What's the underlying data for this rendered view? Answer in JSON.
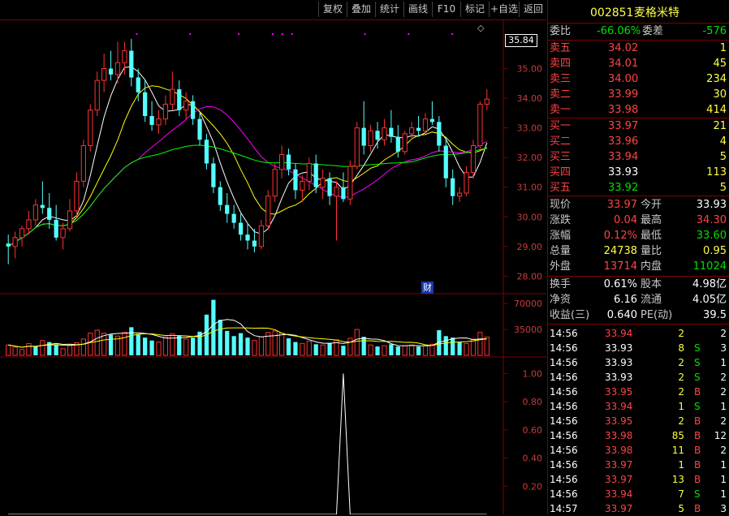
{
  "toolbar": {
    "buttons": [
      "复权",
      "叠加",
      "统计",
      "画线",
      "F10",
      "标记",
      "+自选",
      "返回"
    ]
  },
  "price_chart": {
    "current_tag": "35.84",
    "y_ticks": [
      "35.00",
      "34.00",
      "33.00",
      "32.00",
      "31.00",
      "30.00",
      "29.00",
      "28.00"
    ],
    "marker_text": "财"
  },
  "volume_chart": {
    "y_ticks": [
      "70000",
      "35000"
    ]
  },
  "indicator_chart": {
    "y_ticks": [
      "1.00",
      "0.80",
      "0.60",
      "0.40",
      "0.20"
    ]
  },
  "stock": {
    "code": "002851",
    "name": "麦格米特"
  },
  "committee": {
    "ratio_label": "委比",
    "ratio_value": "-66.06%",
    "diff_label": "委差",
    "diff_value": "-576"
  },
  "sell_orders": [
    {
      "label": "卖五",
      "price": "34.02",
      "vol": "1"
    },
    {
      "label": "卖四",
      "price": "34.01",
      "vol": "45"
    },
    {
      "label": "卖三",
      "price": "34.00",
      "vol": "234"
    },
    {
      "label": "卖二",
      "price": "33.99",
      "vol": "30"
    },
    {
      "label": "卖一",
      "price": "33.98",
      "vol": "414"
    }
  ],
  "buy_orders": [
    {
      "label": "买一",
      "price": "33.97",
      "vol": "21"
    },
    {
      "label": "买二",
      "price": "33.96",
      "vol": "4"
    },
    {
      "label": "买三",
      "price": "33.94",
      "vol": "5"
    },
    {
      "label": "买四",
      "price": "33.93",
      "vol": "113"
    },
    {
      "label": "买五",
      "price": "33.92",
      "vol": "5"
    }
  ],
  "quote": [
    {
      "l1": "现价",
      "v1": "33.97",
      "l2": "今开",
      "v2": "33.93"
    },
    {
      "l1": "涨跌",
      "v1": "0.04",
      "l2": "最高",
      "v2": "34.30"
    },
    {
      "l1": "涨幅",
      "v1": "0.12%",
      "l2": "最低",
      "v2": "33.60"
    },
    {
      "l1": "总量",
      "v1": "24738",
      "l2": "量比",
      "v2": "0.95"
    },
    {
      "l1": "外盘",
      "v1": "13714",
      "l2": "内盘",
      "v2": "11024"
    }
  ],
  "fundamentals": [
    {
      "l1": "换手",
      "v1": "0.61%",
      "l2": "股本",
      "v2": "4.98亿"
    },
    {
      "l1": "净资",
      "v1": "6.16",
      "l2": "流通",
      "v2": "4.05亿"
    },
    {
      "l1": "收益(三)",
      "v1": "0.640",
      "l2": "PE(动)",
      "v2": "39.5"
    }
  ],
  "ticks": [
    {
      "time": "14:56",
      "price": "33.94",
      "vol": "2",
      "dir": "",
      "n": "2"
    },
    {
      "time": "14:56",
      "price": "33.93",
      "vol": "8",
      "dir": "S",
      "n": "3"
    },
    {
      "time": "14:56",
      "price": "33.93",
      "vol": "2",
      "dir": "S",
      "n": "1"
    },
    {
      "time": "14:56",
      "price": "33.93",
      "vol": "2",
      "dir": "S",
      "n": "2"
    },
    {
      "time": "14:56",
      "price": "33.95",
      "vol": "2",
      "dir": "B",
      "n": "2"
    },
    {
      "time": "14:56",
      "price": "33.94",
      "vol": "1",
      "dir": "S",
      "n": "1"
    },
    {
      "time": "14:56",
      "price": "33.95",
      "vol": "2",
      "dir": "B",
      "n": "2"
    },
    {
      "time": "14:56",
      "price": "33.98",
      "vol": "85",
      "dir": "B",
      "n": "12"
    },
    {
      "time": "14:56",
      "price": "33.98",
      "vol": "11",
      "dir": "B",
      "n": "2"
    },
    {
      "time": "14:56",
      "price": "33.97",
      "vol": "1",
      "dir": "B",
      "n": "1"
    },
    {
      "time": "14:56",
      "price": "33.97",
      "vol": "13",
      "dir": "B",
      "n": "1"
    },
    {
      "time": "14:56",
      "price": "33.94",
      "vol": "7",
      "dir": "S",
      "n": "1"
    },
    {
      "time": "14:57",
      "price": "33.97",
      "vol": "5",
      "dir": "B",
      "n": "3"
    }
  ],
  "colors": {
    "up": "#ff3232",
    "down": "#54ffff",
    "ma5": "#ffffff",
    "ma10": "#ffff00",
    "ma20": "#ff00ff",
    "ma60": "#00ff00",
    "frame": "#800000"
  },
  "chart_data": {
    "type": "candlestick",
    "ylim": [
      27.6,
      36.3
    ],
    "volume_ylim": [
      0,
      80000
    ],
    "indicator_ylim": [
      0,
      1.1
    ],
    "candles": [
      [
        29.1,
        29.4,
        28.4,
        29.0
      ],
      [
        29.0,
        29.5,
        28.6,
        29.3
      ],
      [
        29.3,
        29.7,
        29.0,
        29.6
      ],
      [
        29.6,
        30.2,
        29.4,
        29.9
      ],
      [
        29.9,
        30.6,
        29.7,
        30.4
      ],
      [
        30.4,
        31.2,
        30.1,
        30.3
      ],
      [
        30.3,
        30.8,
        29.6,
        29.9
      ],
      [
        29.9,
        30.4,
        29.2,
        29.3
      ],
      [
        29.3,
        29.8,
        28.9,
        29.6
      ],
      [
        29.6,
        30.6,
        29.5,
        30.2
      ],
      [
        30.2,
        31.5,
        30.0,
        31.2
      ],
      [
        31.2,
        32.6,
        31.0,
        32.4
      ],
      [
        32.4,
        33.8,
        32.2,
        33.6
      ],
      [
        33.6,
        34.9,
        33.4,
        34.6
      ],
      [
        34.6,
        35.5,
        34.2,
        35.0
      ],
      [
        35.0,
        35.6,
        34.6,
        34.8
      ],
      [
        34.8,
        35.9,
        34.5,
        35.2
      ],
      [
        35.2,
        35.9,
        34.8,
        35.6
      ],
      [
        35.6,
        36.0,
        34.4,
        34.7
      ],
      [
        34.7,
        35.0,
        33.9,
        34.2
      ],
      [
        34.2,
        34.6,
        33.2,
        33.4
      ],
      [
        33.4,
        33.9,
        32.9,
        33.1
      ],
      [
        33.1,
        33.6,
        32.8,
        33.3
      ],
      [
        33.3,
        34.1,
        33.1,
        33.8
      ],
      [
        33.8,
        34.9,
        33.6,
        34.3
      ],
      [
        34.3,
        34.6,
        33.4,
        33.6
      ],
      [
        33.6,
        34.2,
        33.3,
        33.9
      ],
      [
        33.9,
        34.1,
        33.1,
        33.3
      ],
      [
        33.3,
        33.5,
        32.4,
        32.6
      ],
      [
        32.6,
        32.8,
        31.6,
        31.8
      ],
      [
        31.8,
        32.0,
        30.8,
        31.0
      ],
      [
        31.0,
        31.2,
        30.2,
        30.4
      ],
      [
        30.4,
        30.8,
        29.8,
        30.1
      ],
      [
        30.1,
        30.4,
        29.6,
        29.8
      ],
      [
        29.8,
        30.1,
        29.2,
        29.4
      ],
      [
        29.4,
        29.8,
        28.9,
        29.2
      ],
      [
        29.2,
        29.6,
        28.8,
        29.0
      ],
      [
        29.0,
        29.9,
        28.9,
        29.7
      ],
      [
        29.7,
        30.9,
        29.6,
        30.7
      ],
      [
        30.7,
        31.8,
        30.5,
        31.6
      ],
      [
        31.6,
        32.4,
        31.3,
        32.1
      ],
      [
        32.1,
        32.3,
        31.4,
        31.6
      ],
      [
        31.6,
        31.8,
        30.6,
        30.9
      ],
      [
        30.9,
        31.4,
        30.5,
        31.2
      ],
      [
        31.2,
        32.0,
        30.9,
        31.8
      ],
      [
        31.8,
        32.1,
        30.8,
        31.0
      ],
      [
        31.0,
        31.6,
        30.6,
        31.3
      ],
      [
        31.3,
        31.5,
        30.4,
        30.7
      ],
      [
        30.7,
        31.2,
        29.2,
        31.0
      ],
      [
        31.0,
        31.5,
        30.5,
        30.6
      ],
      [
        30.6,
        31.9,
        30.4,
        31.7
      ],
      [
        31.7,
        33.2,
        31.6,
        33.0
      ],
      [
        33.0,
        33.9,
        32.1,
        32.4
      ],
      [
        32.4,
        33.1,
        32.2,
        32.9
      ],
      [
        32.9,
        33.2,
        32.3,
        32.6
      ],
      [
        32.6,
        33.3,
        32.4,
        33.0
      ],
      [
        33.0,
        33.6,
        32.5,
        32.7
      ],
      [
        32.7,
        33.1,
        32.0,
        32.2
      ],
      [
        32.2,
        32.9,
        32.1,
        32.8
      ],
      [
        32.8,
        33.2,
        32.6,
        33.0
      ],
      [
        33.0,
        33.4,
        32.7,
        32.9
      ],
      [
        32.9,
        33.5,
        32.8,
        33.3
      ],
      [
        33.3,
        33.9,
        33.1,
        33.2
      ],
      [
        33.2,
        33.4,
        32.2,
        32.4
      ],
      [
        32.4,
        32.7,
        31.0,
        31.3
      ],
      [
        31.3,
        31.6,
        30.4,
        30.7
      ],
      [
        30.7,
        31.0,
        30.5,
        30.8
      ],
      [
        30.8,
        31.7,
        30.7,
        31.5
      ],
      [
        31.5,
        32.6,
        31.3,
        32.4
      ],
      [
        32.4,
        33.9,
        32.3,
        33.8
      ],
      [
        33.8,
        34.3,
        33.6,
        33.97
      ]
    ],
    "volumes": [
      [
        14000,
        1
      ],
      [
        11000,
        1
      ],
      [
        8000,
        1
      ],
      [
        16000,
        1
      ],
      [
        12000,
        0
      ],
      [
        20000,
        1
      ],
      [
        18000,
        0
      ],
      [
        15000,
        0
      ],
      [
        9000,
        1
      ],
      [
        13000,
        1
      ],
      [
        17000,
        1
      ],
      [
        22000,
        1
      ],
      [
        30000,
        1
      ],
      [
        34000,
        1
      ],
      [
        30000,
        1
      ],
      [
        28000,
        0
      ],
      [
        26000,
        1
      ],
      [
        31000,
        1
      ],
      [
        38000,
        0
      ],
      [
        29000,
        0
      ],
      [
        24000,
        0
      ],
      [
        20000,
        0
      ],
      [
        18000,
        1
      ],
      [
        25000,
        1
      ],
      [
        29000,
        1
      ],
      [
        27000,
        0
      ],
      [
        22000,
        1
      ],
      [
        24000,
        0
      ],
      [
        32000,
        0
      ],
      [
        55000,
        0
      ],
      [
        75000,
        0
      ],
      [
        48000,
        0
      ],
      [
        33000,
        0
      ],
      [
        26000,
        0
      ],
      [
        30000,
        0
      ],
      [
        24000,
        0
      ],
      [
        20000,
        1
      ],
      [
        25000,
        1
      ],
      [
        31000,
        1
      ],
      [
        33000,
        1
      ],
      [
        30000,
        1
      ],
      [
        23000,
        0
      ],
      [
        18000,
        0
      ],
      [
        16000,
        1
      ],
      [
        19000,
        1
      ],
      [
        15000,
        0
      ],
      [
        14000,
        1
      ],
      [
        17000,
        0
      ],
      [
        21000,
        1
      ],
      [
        13000,
        0
      ],
      [
        23000,
        1
      ],
      [
        35000,
        1
      ],
      [
        25000,
        0
      ],
      [
        14000,
        1
      ],
      [
        12000,
        0
      ],
      [
        13000,
        1
      ],
      [
        15000,
        0
      ],
      [
        12000,
        0
      ],
      [
        13000,
        1
      ],
      [
        14000,
        1
      ],
      [
        12000,
        0
      ],
      [
        13000,
        1
      ],
      [
        15000,
        1
      ],
      [
        34000,
        0
      ],
      [
        26000,
        0
      ],
      [
        24000,
        0
      ],
      [
        18000,
        0
      ],
      [
        16000,
        1
      ],
      [
        22000,
        1
      ],
      [
        31000,
        1
      ],
      [
        24738,
        1
      ]
    ],
    "indicator": {
      "peak_index": 49,
      "peak_value": 1.0
    }
  }
}
